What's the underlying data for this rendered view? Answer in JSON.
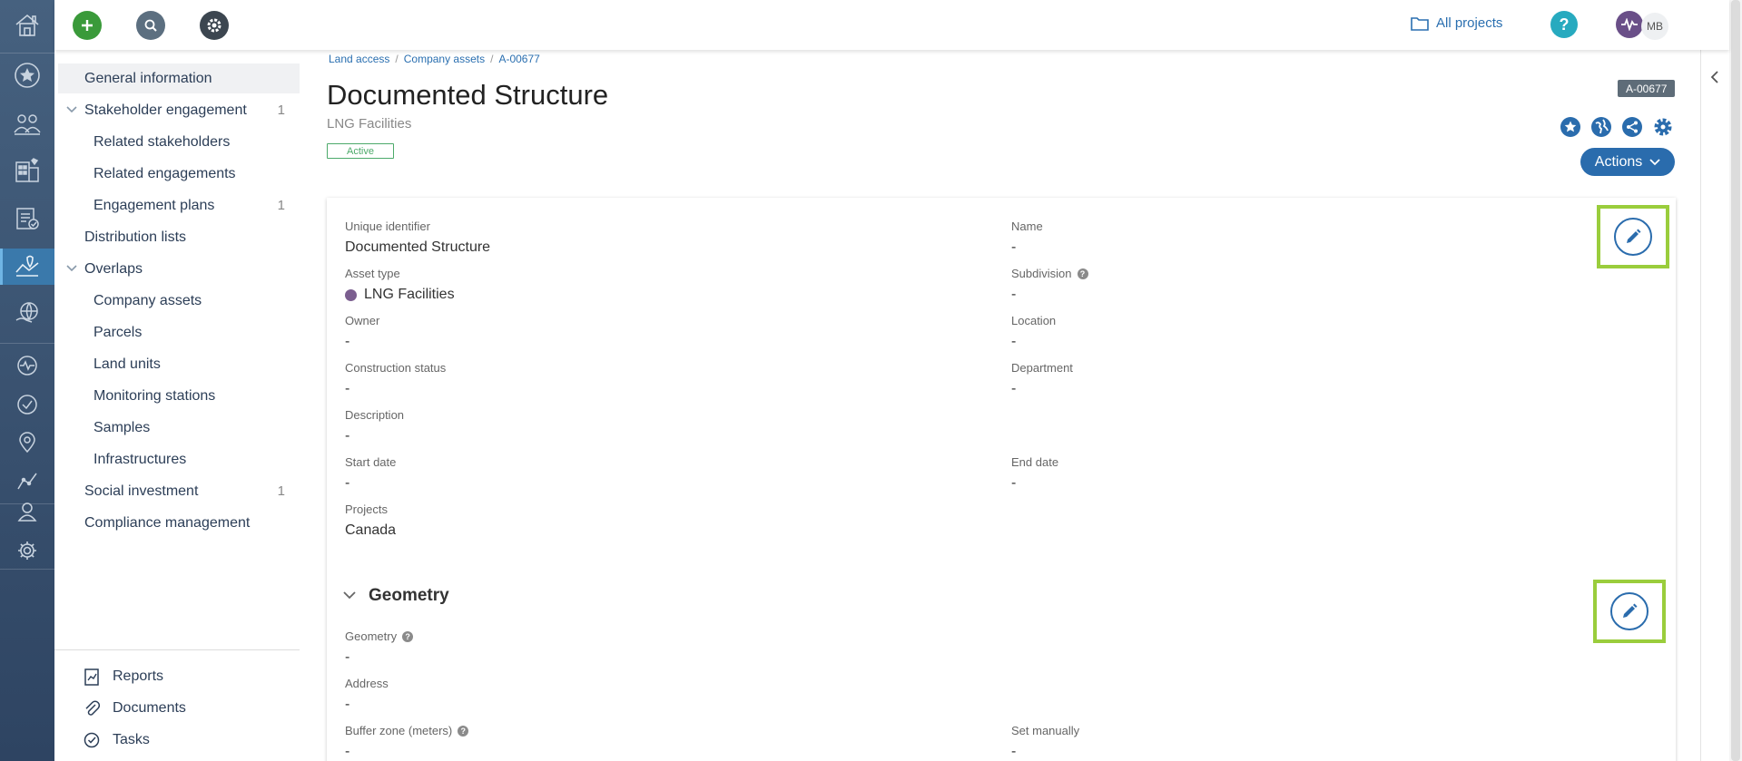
{
  "topbar": {
    "all_projects_label": "All projects",
    "avatar_initials": "MB",
    "colors": {
      "add": "#3a9a3a",
      "search": "#5c6f80",
      "settings": "#3c4650",
      "help": "#27aabf",
      "activity": "#6a4f88"
    }
  },
  "sidebar": {
    "items": [
      {
        "label": "General information"
      },
      {
        "label": "Stakeholder engagement",
        "count": "1"
      },
      {
        "label": "Related stakeholders"
      },
      {
        "label": "Related engagements"
      },
      {
        "label": "Engagement plans",
        "count": "1"
      },
      {
        "label": "Distribution lists"
      },
      {
        "label": "Overlaps"
      },
      {
        "label": "Company assets"
      },
      {
        "label": "Parcels"
      },
      {
        "label": "Land units"
      },
      {
        "label": "Monitoring stations"
      },
      {
        "label": "Samples"
      },
      {
        "label": "Infrastructures"
      },
      {
        "label": "Social investment",
        "count": "1"
      },
      {
        "label": "Compliance management"
      }
    ],
    "footer": [
      {
        "label": "Reports"
      },
      {
        "label": "Documents"
      },
      {
        "label": "Tasks"
      }
    ]
  },
  "breadcrumb": [
    "Land access",
    "Company assets",
    "A-00677"
  ],
  "header": {
    "title": "Documented Structure",
    "subtitle": "LNG Facilities",
    "status": "Active",
    "id_tag": "A-00677",
    "actions_label": "Actions"
  },
  "details": {
    "unique_identifier": {
      "label": "Unique identifier",
      "value": "Documented Structure"
    },
    "name": {
      "label": "Name",
      "value": "-"
    },
    "asset_type": {
      "label": "Asset type",
      "value": "LNG Facilities",
      "color": "#7b5e8f"
    },
    "subdivision": {
      "label": "Subdivision",
      "value": "-"
    },
    "owner": {
      "label": "Owner",
      "value": "-"
    },
    "location": {
      "label": "Location",
      "value": "-"
    },
    "construction_status": {
      "label": "Construction status",
      "value": "-"
    },
    "department": {
      "label": "Department",
      "value": "-"
    },
    "description": {
      "label": "Description",
      "value": "-"
    },
    "start_date": {
      "label": "Start date",
      "value": "-"
    },
    "end_date": {
      "label": "End date",
      "value": "-"
    },
    "projects": {
      "label": "Projects",
      "value": "Canada"
    }
  },
  "geometry": {
    "title": "Geometry",
    "geometry": {
      "label": "Geometry",
      "value": "-"
    },
    "address": {
      "label": "Address",
      "value": "-"
    },
    "buffer_zone": {
      "label": "Buffer zone (meters)",
      "value": "-"
    },
    "set_manually": {
      "label": "Set manually",
      "value": "-"
    }
  },
  "help_glyph": "?"
}
